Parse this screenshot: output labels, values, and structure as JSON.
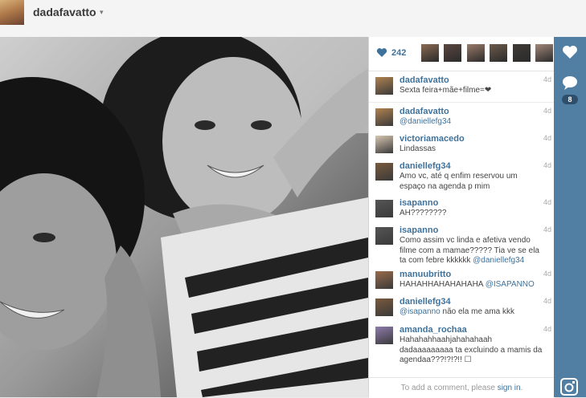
{
  "header": {
    "username": "dadafavatto",
    "caret": "▾"
  },
  "likes": {
    "count": "242",
    "likers": [
      {
        "color": "#8a6a52"
      },
      {
        "color": "#5b4640"
      },
      {
        "color": "#9b7a6a"
      },
      {
        "color": "#6c5a4a"
      },
      {
        "color": "#3e3a36"
      },
      {
        "color": "#a1877a"
      }
    ]
  },
  "comments": [
    {
      "user": "dadafavatto",
      "time": "4d",
      "text": "Sexta feira+mãe+filme=❤",
      "avatar": "#b0824f"
    },
    {
      "user": "dadafavatto",
      "time": "4d",
      "text": "@daniellefg34",
      "avatar": "#b0824f"
    },
    {
      "user": "victoriamacedo",
      "time": "4d",
      "text": "Lindassas",
      "avatar": "#d8c7b2"
    },
    {
      "user": "daniellefg34",
      "time": "4d",
      "text": "Amo vc, até q enfim reservou um espaço na agenda p mim",
      "avatar": "#7a5a3c"
    },
    {
      "user": "isapanno",
      "time": "4d",
      "text": "AH????????",
      "avatar": "#555555"
    },
    {
      "user": "isapanno",
      "time": "4d",
      "text": "Como assim vc linda e afetiva vendo filme com a mamae????? Tia ve se ela ta com febre kkkkkk",
      "mention": "@daniellefg34",
      "avatar": "#555555"
    },
    {
      "user": "manuubritto",
      "time": "4d",
      "text": "HAHAHHAHAHAHAHA",
      "mention": "@ISAPANNO",
      "avatar": "#9a6b4a"
    },
    {
      "user": "daniellefg34",
      "time": "4d",
      "text": "não ela me ama kkk",
      "mention": "@isapanno",
      "avatar": "#7a5a3c"
    },
    {
      "user": "amanda_rochaa",
      "time": "4d",
      "text": "Hahahahhaahjahahahaah dadaaaaaaaaa ta excluindo a mamis da agendaa???!?!?!! ☐",
      "avatar": "#8f7cae"
    }
  ],
  "add_comment": {
    "prefix": "To add a comment, please ",
    "link": "sign in",
    "suffix": "."
  },
  "actions": {
    "comment_count": "8"
  },
  "colors": {
    "accent": "#3f729b",
    "action_bar": "#517fa4"
  },
  "icons": [
    "heart-icon",
    "comment-icon",
    "instagram-icon"
  ]
}
